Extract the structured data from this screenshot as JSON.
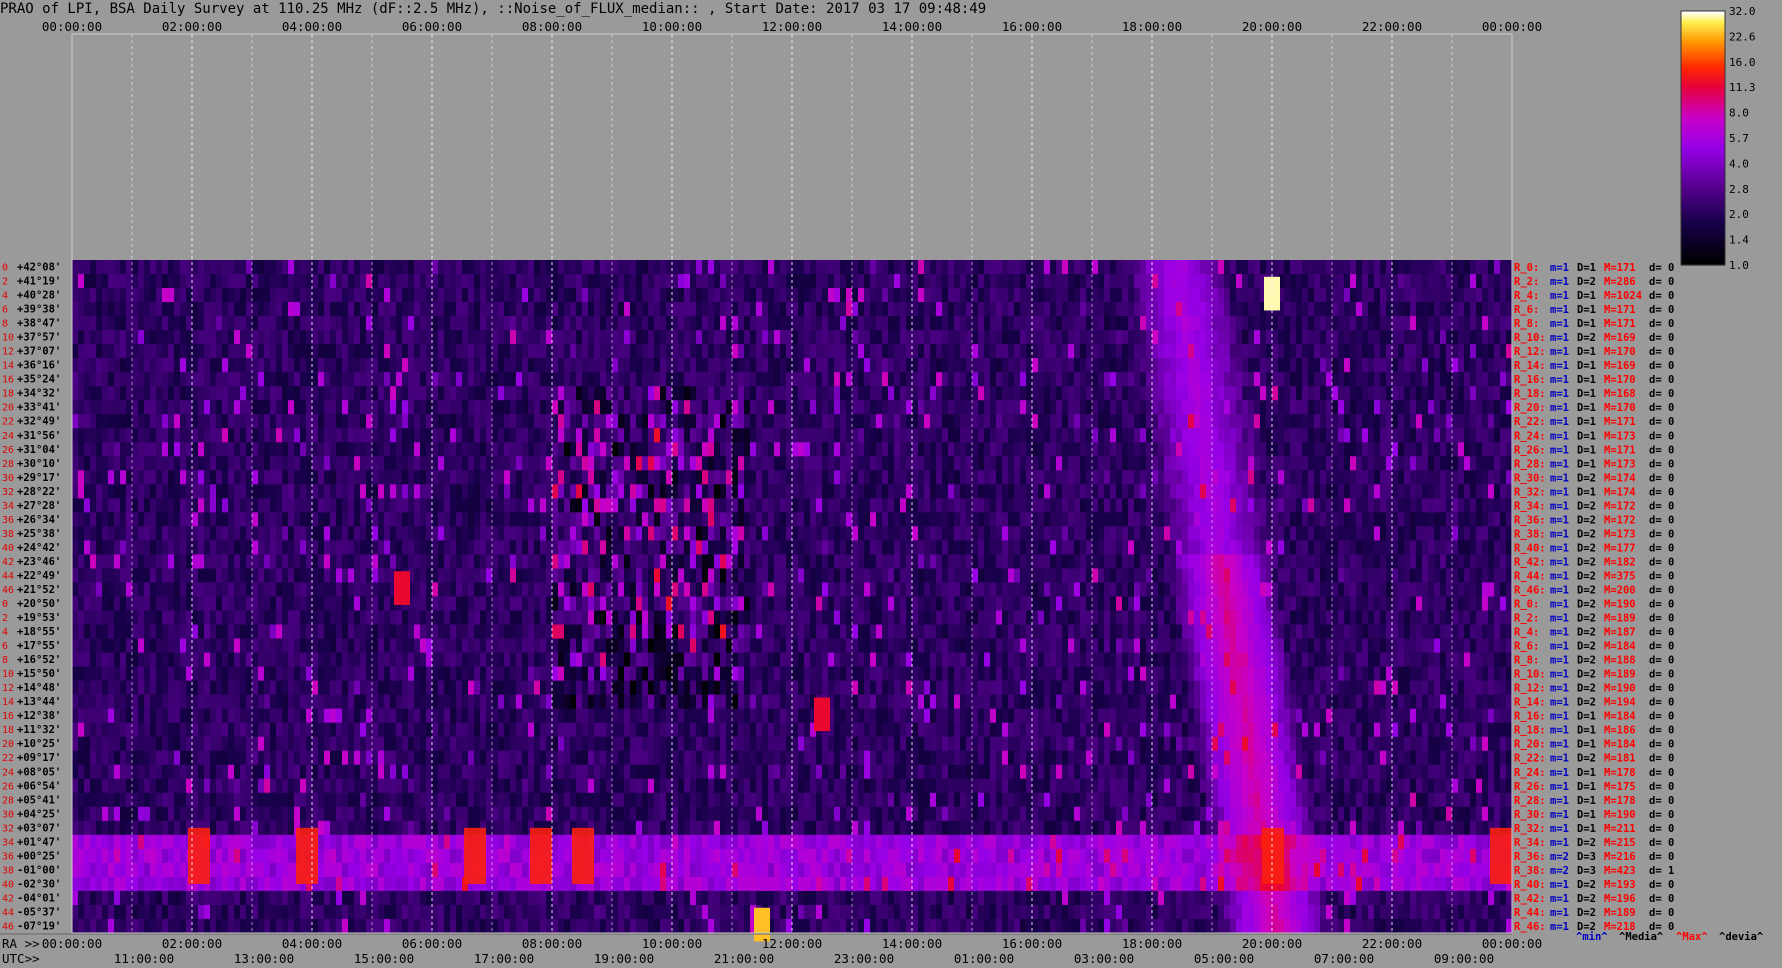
{
  "title": "PRAO of LPI, BSA Daily Survey at 110.25 MHz (dF::2.5 MHz), ::Noise_of_FLUX_median:: , Start Date: 2017 03 17 09:48:49",
  "colors": {
    "background": "#9a9a9a",
    "text": "#000000",
    "row_label": "#e00000",
    "min_label": "#0000c0",
    "median_label": "#000000",
    "max_label": "#ff0000",
    "dev_label": "#000000"
  },
  "chart_data": {
    "type": "heatmap",
    "title": "PRAO of LPI, BSA Daily Survey at 110.25 MHz (dF::2.5 MHz), ::Noise_of_FLUX_median:: , Start Date: 2017 03 17 09:48:49",
    "top_axis_ticks": [
      "00:00:00",
      "02:00:00",
      "04:00:00",
      "06:00:00",
      "08:00:00",
      "10:00:00",
      "12:00:00",
      "14:00:00",
      "16:00:00",
      "18:00:00",
      "20:00:00",
      "22:00:00",
      "00:00:00"
    ],
    "ra_axis_label": "RA >>",
    "ra_ticks": [
      "00:00:00",
      "02:00:00",
      "04:00:00",
      "06:00:00",
      "08:00:00",
      "10:00:00",
      "12:00:00",
      "14:00:00",
      "16:00:00",
      "18:00:00",
      "20:00:00",
      "22:00:00",
      "00:00:00"
    ],
    "utc_axis_label": "UTC>>",
    "utc_ticks": [
      "11:00:00",
      "13:00:00",
      "15:00:00",
      "17:00:00",
      "19:00:00",
      "21:00:00",
      "23:00:00",
      "01:00:00",
      "03:00:00",
      "05:00:00",
      "07:00:00",
      "09:00:00"
    ],
    "declinations": [
      "+42°08'",
      "+41°19'",
      "+40°28'",
      "+39°38'",
      "+38°47'",
      "+37°57'",
      "+37°07'",
      "+36°16'",
      "+35°24'",
      "+34°32'",
      "+33°41'",
      "+32°49'",
      "+31°56'",
      "+31°04'",
      "+30°10'",
      "+29°17'",
      "+28°22'",
      "+27°28'",
      "+26°34'",
      "+25°38'",
      "+24°42'",
      "+23°46'",
      "+22°49'",
      "+21°52'",
      "+20°50'",
      "+19°53'",
      "+18°55'",
      "+17°55'",
      "+16°52'",
      "+15°50'",
      "+14°48'",
      "+13°44'",
      "+12°38'",
      "+11°32'",
      "+10°25'",
      "+09°17'",
      "+08°05'",
      "+06°54'",
      "+05°41'",
      "+04°25'",
      "+03°07'",
      "+01°47'",
      "+00°25'",
      "-01°00'",
      "-02°30'",
      "-04°01'",
      "-05°37'",
      "-07°19'"
    ],
    "row_stats": [
      {
        "r": "R_0:",
        "m": "m=1",
        "D": "D=1",
        "M": "M=171",
        "d": "d= 0"
      },
      {
        "r": "R_2:",
        "m": "m=1",
        "D": "D=2",
        "M": "M=286",
        "d": "d= 0"
      },
      {
        "r": "R_4:",
        "m": "m=1",
        "D": "D=1",
        "M": "M=1024",
        "d": "d= 0"
      },
      {
        "r": "R_6:",
        "m": "m=1",
        "D": "D=1",
        "M": "M=171",
        "d": "d= 0"
      },
      {
        "r": "R_8:",
        "m": "m=1",
        "D": "D=1",
        "M": "M=171",
        "d": "d= 0"
      },
      {
        "r": "R_10:",
        "m": "m=1",
        "D": "D=2",
        "M": "M=169",
        "d": "d= 0"
      },
      {
        "r": "R_12:",
        "m": "m=1",
        "D": "D=1",
        "M": "M=170",
        "d": "d= 0"
      },
      {
        "r": "R_14:",
        "m": "m=1",
        "D": "D=1",
        "M": "M=169",
        "d": "d= 0"
      },
      {
        "r": "R_16:",
        "m": "m=1",
        "D": "D=1",
        "M": "M=170",
        "d": "d= 0"
      },
      {
        "r": "R_18:",
        "m": "m=1",
        "D": "D=1",
        "M": "M=168",
        "d": "d= 0"
      },
      {
        "r": "R_20:",
        "m": "m=1",
        "D": "D=1",
        "M": "M=170",
        "d": "d= 0"
      },
      {
        "r": "R_22:",
        "m": "m=1",
        "D": "D=1",
        "M": "M=171",
        "d": "d= 0"
      },
      {
        "r": "R_24:",
        "m": "m=1",
        "D": "D=1",
        "M": "M=173",
        "d": "d= 0"
      },
      {
        "r": "R_26:",
        "m": "m=1",
        "D": "D=1",
        "M": "M=171",
        "d": "d= 0"
      },
      {
        "r": "R_28:",
        "m": "m=1",
        "D": "D=1",
        "M": "M=173",
        "d": "d= 0"
      },
      {
        "r": "R_30:",
        "m": "m=1",
        "D": "D=2",
        "M": "M=174",
        "d": "d= 0"
      },
      {
        "r": "R_32:",
        "m": "m=1",
        "D": "D=1",
        "M": "M=174",
        "d": "d= 0"
      },
      {
        "r": "R_34:",
        "m": "m=1",
        "D": "D=2",
        "M": "M=172",
        "d": "d= 0"
      },
      {
        "r": "R_36:",
        "m": "m=1",
        "D": "D=2",
        "M": "M=172",
        "d": "d= 0"
      },
      {
        "r": "R_38:",
        "m": "m=1",
        "D": "D=2",
        "M": "M=173",
        "d": "d= 0"
      },
      {
        "r": "R_40:",
        "m": "m=1",
        "D": "D=2",
        "M": "M=177",
        "d": "d= 0"
      },
      {
        "r": "R_42:",
        "m": "m=1",
        "D": "D=2",
        "M": "M=182",
        "d": "d= 0"
      },
      {
        "r": "R_44:",
        "m": "m=1",
        "D": "D=2",
        "M": "M=375",
        "d": "d= 0"
      },
      {
        "r": "R_46:",
        "m": "m=1",
        "D": "D=2",
        "M": "M=200",
        "d": "d= 0"
      },
      {
        "r": "R_0:",
        "m": "m=1",
        "D": "D=2",
        "M": "M=190",
        "d": "d= 0"
      },
      {
        "r": "R_2:",
        "m": "m=1",
        "D": "D=2",
        "M": "M=189",
        "d": "d= 0"
      },
      {
        "r": "R_4:",
        "m": "m=1",
        "D": "D=2",
        "M": "M=187",
        "d": "d= 0"
      },
      {
        "r": "R_6:",
        "m": "m=1",
        "D": "D=2",
        "M": "M=184",
        "d": "d= 0"
      },
      {
        "r": "R_8:",
        "m": "m=1",
        "D": "D=2",
        "M": "M=188",
        "d": "d= 0"
      },
      {
        "r": "R_10:",
        "m": "m=1",
        "D": "D=2",
        "M": "M=189",
        "d": "d= 0"
      },
      {
        "r": "R_12:",
        "m": "m=1",
        "D": "D=2",
        "M": "M=190",
        "d": "d= 0"
      },
      {
        "r": "R_14:",
        "m": "m=1",
        "D": "D=2",
        "M": "M=194",
        "d": "d= 0"
      },
      {
        "r": "R_16:",
        "m": "m=1",
        "D": "D=1",
        "M": "M=184",
        "d": "d= 0"
      },
      {
        "r": "R_18:",
        "m": "m=1",
        "D": "D=1",
        "M": "M=186",
        "d": "d= 0"
      },
      {
        "r": "R_20:",
        "m": "m=1",
        "D": "D=1",
        "M": "M=184",
        "d": "d= 0"
      },
      {
        "r": "R_22:",
        "m": "m=1",
        "D": "D=2",
        "M": "M=181",
        "d": "d= 0"
      },
      {
        "r": "R_24:",
        "m": "m=1",
        "D": "D=1",
        "M": "M=178",
        "d": "d= 0"
      },
      {
        "r": "R_26:",
        "m": "m=1",
        "D": "D=1",
        "M": "M=175",
        "d": "d= 0"
      },
      {
        "r": "R_28:",
        "m": "m=1",
        "D": "D=1",
        "M": "M=178",
        "d": "d= 0"
      },
      {
        "r": "R_30:",
        "m": "m=1",
        "D": "D=1",
        "M": "M=190",
        "d": "d= 0"
      },
      {
        "r": "R_32:",
        "m": "m=1",
        "D": "D=1",
        "M": "M=211",
        "d": "d= 0"
      },
      {
        "r": "R_34:",
        "m": "m=1",
        "D": "D=2",
        "M": "M=215",
        "d": "d= 0"
      },
      {
        "r": "R_36:",
        "m": "m=2",
        "D": "D=3",
        "M": "M=216",
        "d": "d= 0"
      },
      {
        "r": "R_38:",
        "m": "m=2",
        "D": "D=3",
        "M": "M=423",
        "d": "d= 1"
      },
      {
        "r": "R_40:",
        "m": "m=1",
        "D": "D=2",
        "M": "M=193",
        "d": "d= 0"
      },
      {
        "r": "R_42:",
        "m": "m=1",
        "D": "D=2",
        "M": "M=196",
        "d": "d= 0"
      },
      {
        "r": "R_44:",
        "m": "m=1",
        "D": "D=2",
        "M": "M=189",
        "d": "d= 0"
      },
      {
        "r": "R_46:",
        "m": "m=1",
        "D": "D=2",
        "M": "M=218",
        "d": "d= 0"
      }
    ],
    "stat_legend": [
      "^min^",
      "^Media^",
      "^Max^",
      "^devia^"
    ],
    "colorbar": {
      "ticks": [
        "32.0",
        "22.6",
        "16.0",
        "11.3",
        "8.0",
        "5.7",
        "4.0",
        "2.8",
        "2.0",
        "1.4",
        "1.0"
      ],
      "range": [
        1.0,
        32.0
      ],
      "scale": "log"
    },
    "features": [
      {
        "name": "equatorial band",
        "dec_range": [
          "+01°47'",
          "-02°30'"
        ],
        "level": 6
      },
      {
        "name": "sources",
        "ra_hours": [
          2.1,
          3.9,
          6.7,
          7.8,
          8.5,
          20.0,
          23.8
        ],
        "dec": "+00°25'",
        "level": 14
      },
      {
        "name": "bright source",
        "ra_hour": 20.0,
        "dec": "+40°28'",
        "level": 30
      },
      {
        "name": "bright source",
        "ra_hour": 11.5,
        "dec": "-07°19'",
        "level": 24
      },
      {
        "name": "bright source",
        "ra_hour": 12.5,
        "dec": "+12°38'",
        "level": 12
      },
      {
        "name": "bright source",
        "ra_hour": 5.5,
        "dec": "+21°52'",
        "level": 12
      },
      {
        "name": "galactic plane",
        "ra_hours": [
          18.5,
          20.2
        ],
        "dec_range": [
          "-07°19'",
          "+42°08'"
        ],
        "level": 8
      },
      {
        "name": "interference cloud",
        "ra_hours": [
          8.0,
          11.2
        ],
        "dec_range": [
          "+33°41'",
          "+13°44'"
        ],
        "level": 6
      }
    ],
    "grid": true
  }
}
